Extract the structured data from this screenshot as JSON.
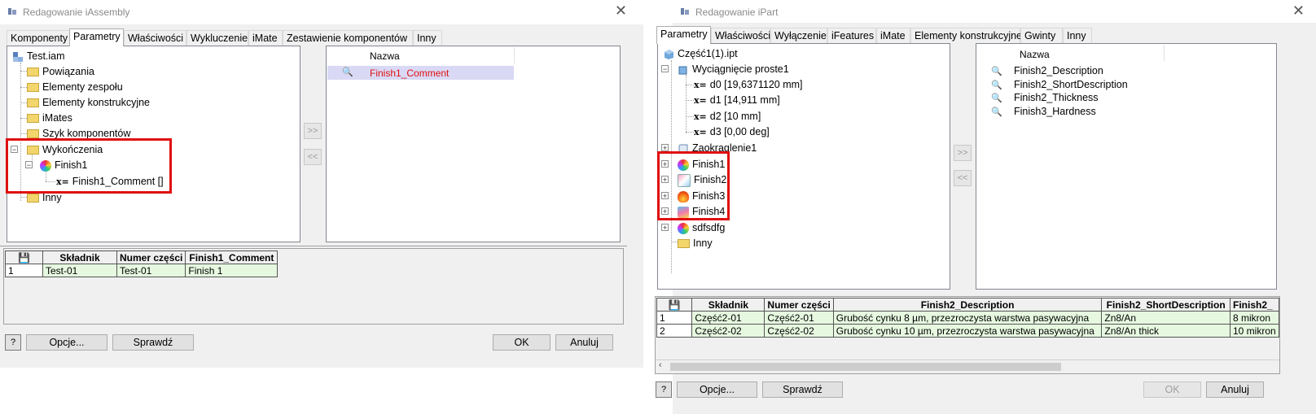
{
  "dlg1": {
    "title": "Redagowanie iAssembly",
    "tabs": [
      "Komponenty",
      "Parametry",
      "Właściwości",
      "Wykluczenie",
      "iMate",
      "Zestawienie komponentów",
      "Inny"
    ],
    "tree": {
      "root": "Test.iam",
      "items": [
        "Powiązania",
        "Elementy zespołu",
        "Elementy konstrukcyjne",
        "iMates",
        "Szyk komponentów",
        "Wykończenia",
        "Finish1",
        "Finish1_Comment []",
        "Inny"
      ]
    },
    "list_header": "Nazwa",
    "list_items": [
      "Finish1_Comment"
    ],
    "move_right": ">>",
    "move_left": "<<",
    "table": {
      "headers": [
        "Składnik",
        "Numer części",
        "Finish1_Comment"
      ],
      "rows": [
        {
          "num": "1",
          "cells": [
            "Test-01",
            "Test-01",
            "Finish 1"
          ]
        }
      ]
    },
    "buttons": {
      "help": "?",
      "options": "Opcje...",
      "check": "Sprawdź",
      "ok": "OK",
      "cancel": "Anuluj"
    }
  },
  "dlg2": {
    "title": "Redagowanie iPart",
    "tabs": [
      "Parametry",
      "Właściwości",
      "Wyłączenie",
      "iFeatures",
      "iMate",
      "Elementy konstrukcyjne",
      "Gwinty",
      "Inny"
    ],
    "tree": {
      "root": "Część1(1).ipt",
      "items": [
        "Wyciągnięcie proste1",
        "d0 [19,6371120 mm]",
        "d1 [14,911 mm]",
        "d2 [10 mm]",
        "d3 [0,00 deg]",
        "Zaokrąglenie1",
        "Finish1",
        "Finish2",
        "Finish3",
        "Finish4",
        "sdfsdfg",
        "Inny"
      ]
    },
    "list_header": "Nazwa",
    "list_items": [
      "Finish2_Description",
      "Finish2_ShortDescription",
      "Finish2_Thickness",
      "Finish3_Hardness"
    ],
    "move_right": ">>",
    "move_left": "<<",
    "table": {
      "headers": [
        "Składnik",
        "Numer części",
        "Finish2_Description",
        "Finish2_ShortDescription",
        "Finish2_"
      ],
      "rows": [
        {
          "num": "1",
          "cells": [
            "Część2-01",
            "Część2-01",
            "Grubość cynku 8 µm, przezroczysta warstwa pasywacyjna",
            "Zn8/An",
            "8 mikron"
          ]
        },
        {
          "num": "2",
          "cells": [
            "Część2-02",
            "Część2-02",
            "Grubość cynku 10 µm, przezroczysta warstwa pasywacyjna",
            "Zn8/An thick",
            "10 mikron"
          ]
        }
      ]
    },
    "buttons": {
      "help": "?",
      "options": "Opcje...",
      "check": "Sprawdź",
      "ok": "OK",
      "cancel": "Anuluj"
    }
  },
  "colors": {
    "highlight_red": "#e01010",
    "selected_text_red": "#e01010",
    "selected_row_bg": "#d9d9f5",
    "green_row": "#e6f9e0"
  }
}
